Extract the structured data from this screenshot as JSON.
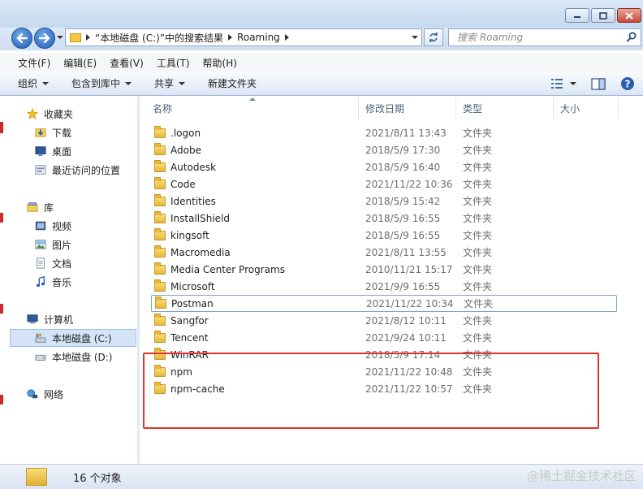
{
  "window": {
    "min_label": "—",
    "max_label": "□",
    "close_label": "✕"
  },
  "address": {
    "location": "“本地磁盘 (C:)”中的搜索结果",
    "current": "Roaming"
  },
  "search": {
    "placeholder": "搜索 Roaming"
  },
  "menu": [
    {
      "label": "文件(F)"
    },
    {
      "label": "编辑(E)"
    },
    {
      "label": "查看(V)"
    },
    {
      "label": "工具(T)"
    },
    {
      "label": "帮助(H)"
    }
  ],
  "toolbar": {
    "organize": "组织",
    "include_in_library": "包含到库中",
    "share": "共享",
    "new_folder": "新建文件夹"
  },
  "nav": {
    "favorites": "收藏夹",
    "downloads": "下载",
    "desktop": "桌面",
    "recent": "最近访问的位置",
    "libraries": "库",
    "videos": "视频",
    "pictures": "图片",
    "documents": "文档",
    "music": "音乐",
    "computer": "计算机",
    "drive_c": "本地磁盘 (C:)",
    "drive_d": "本地磁盘 (D:)",
    "network": "网络"
  },
  "columns": {
    "name": "名称",
    "date": "修改日期",
    "type": "类型",
    "size": "大小"
  },
  "files": [
    {
      "name": ".logon",
      "date": "2021/8/11 13:43",
      "type": "文件夹"
    },
    {
      "name": "Adobe",
      "date": "2018/5/9 17:30",
      "type": "文件夹"
    },
    {
      "name": "Autodesk",
      "date": "2018/5/9 16:40",
      "type": "文件夹"
    },
    {
      "name": "Code",
      "date": "2021/11/22 10:36",
      "type": "文件夹"
    },
    {
      "name": "Identities",
      "date": "2018/5/9 15:42",
      "type": "文件夹"
    },
    {
      "name": "InstallShield",
      "date": "2018/5/9 16:55",
      "type": "文件夹"
    },
    {
      "name": "kingsoft",
      "date": "2018/5/9 16:55",
      "type": "文件夹"
    },
    {
      "name": "Macromedia",
      "date": "2021/8/11 13:55",
      "type": "文件夹"
    },
    {
      "name": "Media Center Programs",
      "date": "2010/11/21 15:17",
      "type": "文件夹"
    },
    {
      "name": "Microsoft",
      "date": "2021/9/9 16:55",
      "type": "文件夹"
    },
    {
      "name": "Postman",
      "date": "2021/11/22 10:34",
      "type": "文件夹"
    },
    {
      "name": "Sangfor",
      "date": "2021/8/12 10:11",
      "type": "文件夹"
    },
    {
      "name": "Tencent",
      "date": "2021/9/24 10:11",
      "type": "文件夹"
    },
    {
      "name": "WinRAR",
      "date": "2018/5/9 17:14",
      "type": "文件夹"
    },
    {
      "name": "npm",
      "date": "2021/11/22 10:48",
      "type": "文件夹"
    },
    {
      "name": "npm-cache",
      "date": "2021/11/22 10:57",
      "type": "文件夹"
    }
  ],
  "status": {
    "count": "16 个对象"
  },
  "watermark": "@稀土掘金技术社区"
}
